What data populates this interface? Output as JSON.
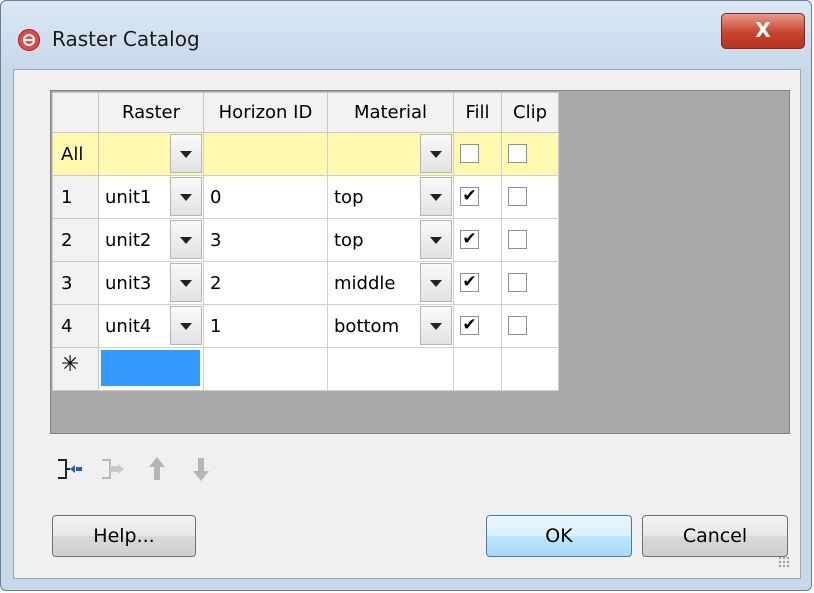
{
  "window": {
    "title": "Raster Catalog",
    "close_glyph": "X",
    "icon": "app-logo-icon"
  },
  "grid": {
    "columns": [
      "Raster",
      "Horizon ID",
      "Material",
      "Fill",
      "Clip"
    ],
    "all_row": {
      "label": "All",
      "fill_checked": false,
      "clip_checked": false
    },
    "rows": [
      {
        "label": "1",
        "raster": "unit1",
        "horizon_id": "0",
        "material": "top",
        "fill": "✔",
        "clip": ""
      },
      {
        "label": "2",
        "raster": "unit2",
        "horizon_id": "3",
        "material": "top",
        "fill": "✔",
        "clip": ""
      },
      {
        "label": "3",
        "raster": "unit3",
        "horizon_id": "2",
        "material": "middle",
        "fill": "✔",
        "clip": ""
      },
      {
        "label": "4",
        "raster": "unit4",
        "horizon_id": "1",
        "material": "bottom",
        "fill": "✔",
        "clip": ""
      }
    ],
    "new_row_marker": "✳"
  },
  "toolbar": {
    "icons": [
      "add-row-icon",
      "remove-row-icon",
      "move-up-icon",
      "move-down-icon"
    ]
  },
  "buttons": {
    "help": "Help...",
    "ok": "OK",
    "cancel": "Cancel"
  }
}
